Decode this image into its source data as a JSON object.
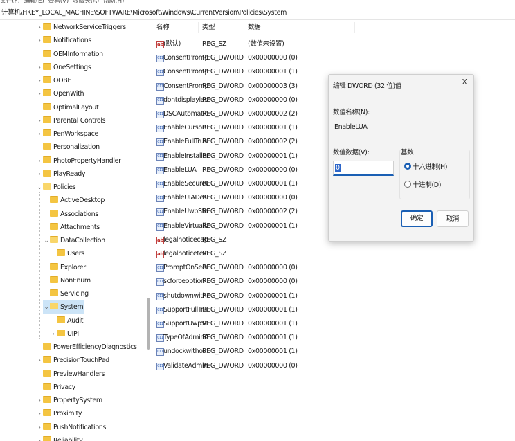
{
  "menu": [
    "文件(F)",
    "编辑(E)",
    "查看(V)",
    "收藏夹(A)",
    "帮助(H)"
  ],
  "address": "计算机\\HKEY_LOCAL_MACHINE\\SOFTWARE\\Microsoft\\Windows\\CurrentVersion\\Policies\\System",
  "tree": [
    {
      "label": "NetworkServiceTriggers",
      "level": 0,
      "chevron": ">"
    },
    {
      "label": "Notifications",
      "level": 0,
      "chevron": ">"
    },
    {
      "label": "OEMInformation",
      "level": 0,
      "chevron": ""
    },
    {
      "label": "OneSettings",
      "level": 0,
      "chevron": ">"
    },
    {
      "label": "OOBE",
      "level": 0,
      "chevron": ">"
    },
    {
      "label": "OpenWith",
      "level": 0,
      "chevron": ">"
    },
    {
      "label": "OptimalLayout",
      "level": 0,
      "chevron": ""
    },
    {
      "label": "Parental Controls",
      "level": 0,
      "chevron": ">"
    },
    {
      "label": "PenWorkspace",
      "level": 0,
      "chevron": ">"
    },
    {
      "label": "Personalization",
      "level": 0,
      "chevron": ""
    },
    {
      "label": "PhotoPropertyHandler",
      "level": 0,
      "chevron": ">"
    },
    {
      "label": "PlayReady",
      "level": 0,
      "chevron": ">"
    },
    {
      "label": "Policies",
      "level": 0,
      "chevron": "v",
      "open": true
    },
    {
      "label": "ActiveDesktop",
      "level": 1,
      "chevron": ""
    },
    {
      "label": "Associations",
      "level": 1,
      "chevron": ""
    },
    {
      "label": "Attachments",
      "level": 1,
      "chevron": ""
    },
    {
      "label": "DataCollection",
      "level": 1,
      "chevron": "v",
      "open": true
    },
    {
      "label": "Users",
      "level": 2,
      "chevron": ""
    },
    {
      "label": "Explorer",
      "level": 1,
      "chevron": ""
    },
    {
      "label": "NonEnum",
      "level": 1,
      "chevron": ""
    },
    {
      "label": "Servicing",
      "level": 1,
      "chevron": ""
    },
    {
      "label": "System",
      "level": 1,
      "chevron": "v",
      "open": true,
      "selected": true
    },
    {
      "label": "Audit",
      "level": 2,
      "chevron": ""
    },
    {
      "label": "UIPI",
      "level": 2,
      "chevron": ">"
    },
    {
      "label": "PowerEfficiencyDiagnostics",
      "level": 0,
      "chevron": ""
    },
    {
      "label": "PrecisionTouchPad",
      "level": 0,
      "chevron": ">"
    },
    {
      "label": "PreviewHandlers",
      "level": 0,
      "chevron": ""
    },
    {
      "label": "Privacy",
      "level": 0,
      "chevron": ""
    },
    {
      "label": "PropertySystem",
      "level": 0,
      "chevron": ">"
    },
    {
      "label": "Proximity",
      "level": 0,
      "chevron": ">"
    },
    {
      "label": "PushNotifications",
      "level": 0,
      "chevron": ">"
    },
    {
      "label": "Reliability",
      "level": 0,
      "chevron": ">"
    }
  ],
  "columns": {
    "name": "名称",
    "type": "类型",
    "data": "数据"
  },
  "values": [
    {
      "name": "(默认)",
      "type": "REG_SZ",
      "data": "(数值未设置)",
      "icon": "ab"
    },
    {
      "name": "ConsentPromp...",
      "type": "REG_DWORD",
      "data": "0x00000000 (0)",
      "icon": "bin"
    },
    {
      "name": "ConsentPromp...",
      "type": "REG_DWORD",
      "data": "0x00000001 (1)",
      "icon": "bin"
    },
    {
      "name": "ConsentPromp...",
      "type": "REG_DWORD",
      "data": "0x00000003 (3)",
      "icon": "bin"
    },
    {
      "name": "dontdisplaylas...",
      "type": "REG_DWORD",
      "data": "0x00000000 (0)",
      "icon": "bin"
    },
    {
      "name": "DSCAutomatio...",
      "type": "REG_DWORD",
      "data": "0x00000002 (2)",
      "icon": "bin"
    },
    {
      "name": "EnableCursorS...",
      "type": "REG_DWORD",
      "data": "0x00000001 (1)",
      "icon": "bin"
    },
    {
      "name": "EnableFullTrust...",
      "type": "REG_DWORD",
      "data": "0x00000002 (2)",
      "icon": "bin"
    },
    {
      "name": "EnableInstaller...",
      "type": "REG_DWORD",
      "data": "0x00000001 (1)",
      "icon": "bin"
    },
    {
      "name": "EnableLUA",
      "type": "REG_DWORD",
      "data": "0x00000000 (0)",
      "icon": "bin"
    },
    {
      "name": "EnableSecureU...",
      "type": "REG_DWORD",
      "data": "0x00000001 (1)",
      "icon": "bin"
    },
    {
      "name": "EnableUIADes...",
      "type": "REG_DWORD",
      "data": "0x00000000 (0)",
      "icon": "bin"
    },
    {
      "name": "EnableUwpSta...",
      "type": "REG_DWORD",
      "data": "0x00000002 (2)",
      "icon": "bin"
    },
    {
      "name": "EnableVirtualiz...",
      "type": "REG_DWORD",
      "data": "0x00000001 (1)",
      "icon": "bin"
    },
    {
      "name": "legalnoticecap...",
      "type": "REG_SZ",
      "data": "",
      "icon": "ab"
    },
    {
      "name": "legalnoticetext",
      "type": "REG_SZ",
      "data": "",
      "icon": "ab"
    },
    {
      "name": "PromptOnSecu...",
      "type": "REG_DWORD",
      "data": "0x00000000 (0)",
      "icon": "bin"
    },
    {
      "name": "scforceoption",
      "type": "REG_DWORD",
      "data": "0x00000000 (0)",
      "icon": "bin"
    },
    {
      "name": "shutdownwitho...",
      "type": "REG_DWORD",
      "data": "0x00000001 (1)",
      "icon": "bin"
    },
    {
      "name": "SupportFullTru...",
      "type": "REG_DWORD",
      "data": "0x00000001 (1)",
      "icon": "bin"
    },
    {
      "name": "SupportUwpSt...",
      "type": "REG_DWORD",
      "data": "0x00000001 (1)",
      "icon": "bin"
    },
    {
      "name": "TypeOfAdminA...",
      "type": "REG_DWORD",
      "data": "0x00000001 (1)",
      "icon": "bin"
    },
    {
      "name": "undockwithout...",
      "type": "REG_DWORD",
      "data": "0x00000001 (1)",
      "icon": "bin"
    },
    {
      "name": "ValidateAdmin...",
      "type": "REG_DWORD",
      "data": "0x00000000 (0)",
      "icon": "bin"
    }
  ],
  "icon_text": {
    "ab": "ab",
    "bin": "011"
  },
  "dialog": {
    "title": "编辑 DWORD (32 位)值",
    "close": "X",
    "name_label": "数值名称(N):",
    "name_value": "EnableLUA",
    "data_label": "数值数据(V):",
    "data_value": "0",
    "base_label": "基数",
    "hex_label": "十六进制(H)",
    "dec_label": "十进制(D)",
    "selected_base": "hex",
    "ok": "确定",
    "cancel": "取消"
  },
  "colors": {
    "accent": "#1a5fb4",
    "folder": "#f4c542",
    "selection": "#cce4f7"
  }
}
